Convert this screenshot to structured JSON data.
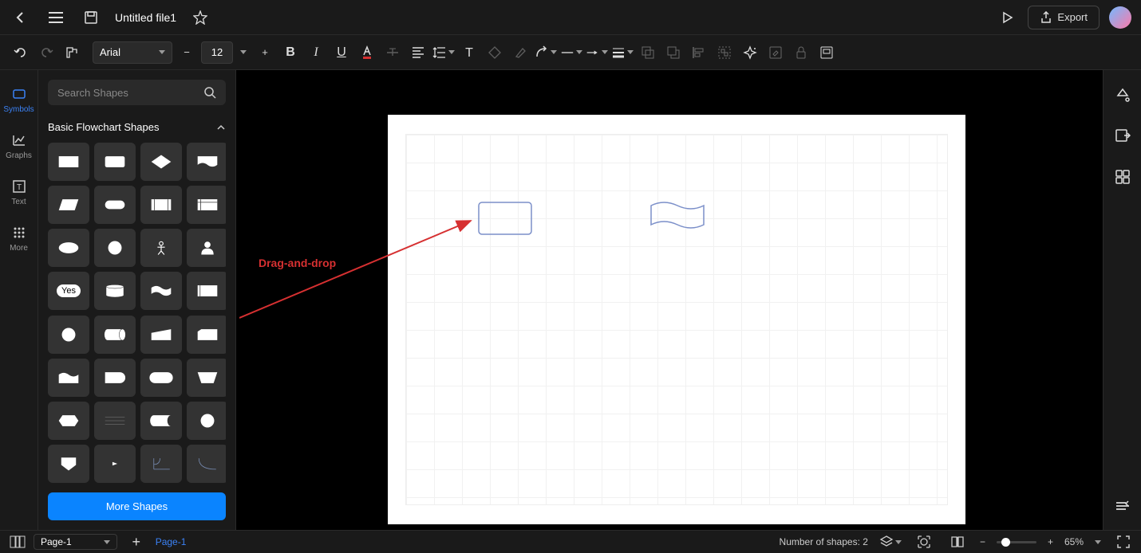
{
  "header": {
    "title": "Untitled file1",
    "export": "Export"
  },
  "toolbar": {
    "font": "Arial",
    "font_size": "12"
  },
  "rail": {
    "symbols": "Symbols",
    "graphs": "Graphs",
    "text": "Text",
    "more": "More"
  },
  "sidebar": {
    "search_placeholder": "Search Shapes",
    "section_title": "Basic Flowchart Shapes",
    "more_shapes": "More Shapes",
    "yes_label": "Yes"
  },
  "canvas": {
    "annotation": "Drag-and-drop"
  },
  "bottom": {
    "page_label": "Page-1",
    "page_tab": "Page-1",
    "shapes_count_label": "Number of shapes: 2",
    "zoom": "65%"
  }
}
